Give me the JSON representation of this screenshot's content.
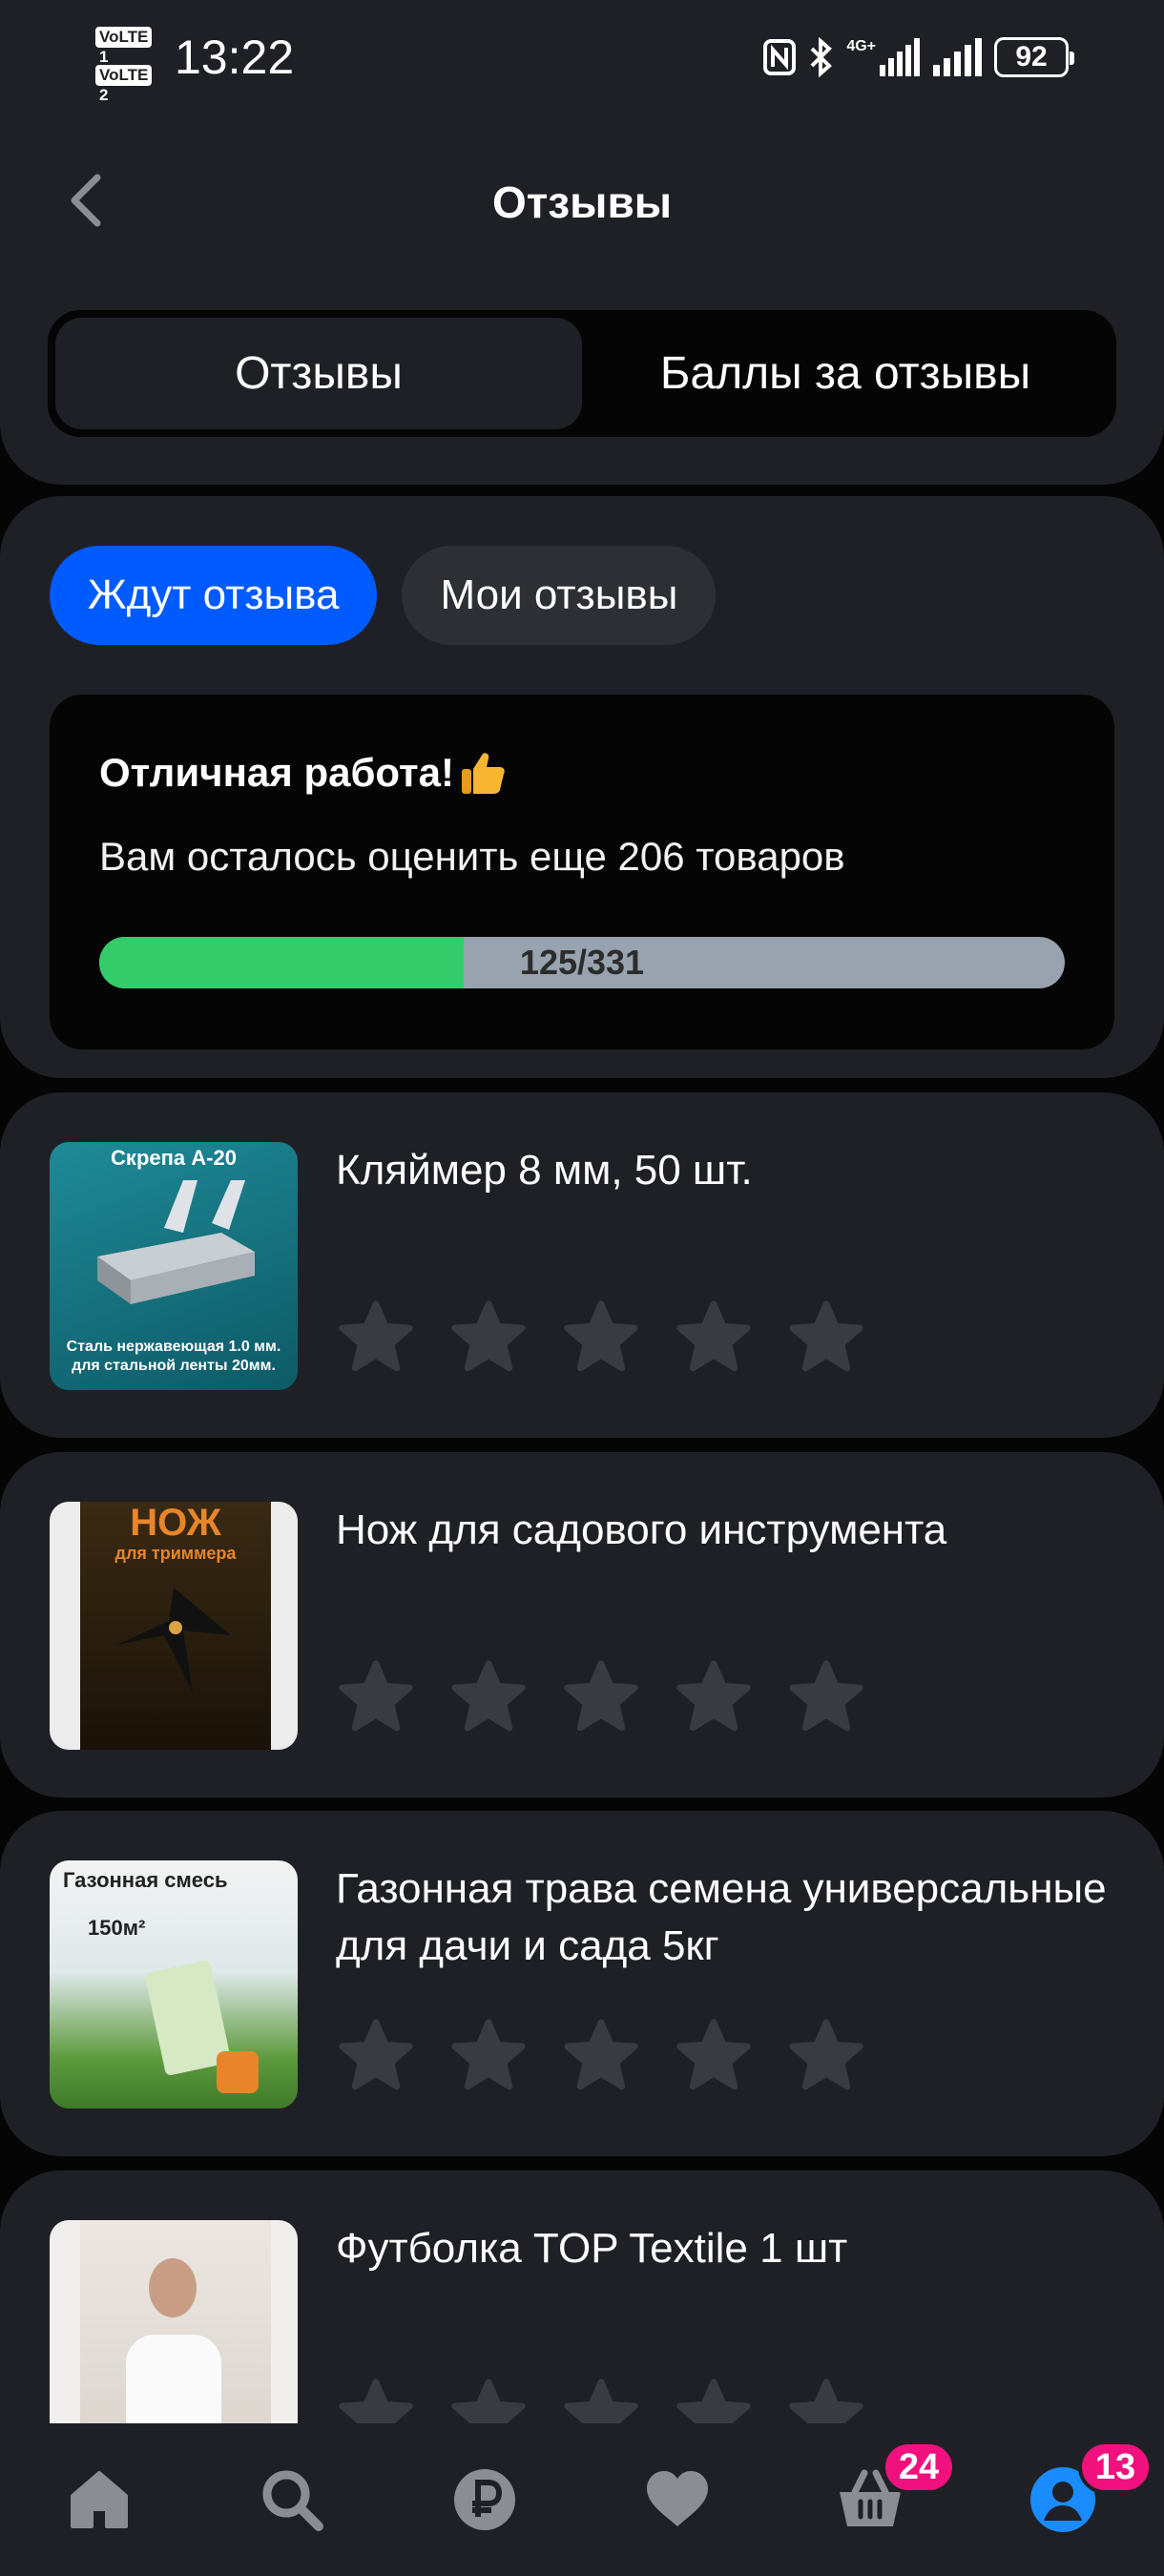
{
  "status_bar": {
    "sim1_label": "VoLTE",
    "sim1_number": "1",
    "sim2_label": "VoLTE",
    "sim2_number": "2",
    "time": "13:22",
    "network": "4G+",
    "battery": "92"
  },
  "header": {
    "title": "Отзывы",
    "back_icon": "chevron-left-icon"
  },
  "segmented": {
    "tabs": [
      {
        "label": "Отзывы",
        "active": true
      },
      {
        "label": "Баллы за отзывы",
        "active": false
      }
    ]
  },
  "filters": {
    "chips": [
      {
        "label": "Ждут отзыва",
        "active": true
      },
      {
        "label": "Мои отзывы",
        "active": false
      }
    ]
  },
  "progress_card": {
    "title": "Отличная работа!",
    "title_icon": "thumbs-up-emoji",
    "subtitle": "Вам осталось оценить еще 206 товаров",
    "done": 125,
    "total": 331,
    "progress_label": "125/331"
  },
  "products": [
    {
      "name": "Кляймер 8 мм, 50 шт.",
      "image_caption_top": "Скрепа А-20",
      "image_caption_bottom": "Сталь нержавеющая 1.0 мм. для стальной ленты 20мм.",
      "rating": 0
    },
    {
      "name": "Нож для садового инструмента",
      "image_caption_top": "НОЖ",
      "image_caption_bottom": "для триммера",
      "rating": 0
    },
    {
      "name": "Газонная трава семена универсальные для дачи и сада 5кг",
      "image_caption_top": "Газонная смесь",
      "image_caption_bottom": "150м²",
      "rating": 0
    },
    {
      "name": "Футболка TOP Textile 1 шт",
      "rating": 0
    }
  ],
  "bottom_nav": {
    "items": [
      {
        "icon": "home-icon"
      },
      {
        "icon": "search-icon"
      },
      {
        "icon": "ruble-icon"
      },
      {
        "icon": "heart-icon"
      },
      {
        "icon": "cart-icon",
        "badge": "24"
      },
      {
        "icon": "profile-icon",
        "badge": "13"
      }
    ]
  },
  "colors": {
    "background": "#050505",
    "panel": "#1f2025",
    "accent": "#005bff",
    "progress": "#34cc6a",
    "badge": "#f1117e",
    "star": "#3a3b41",
    "profile_active": "#1a8cff"
  }
}
